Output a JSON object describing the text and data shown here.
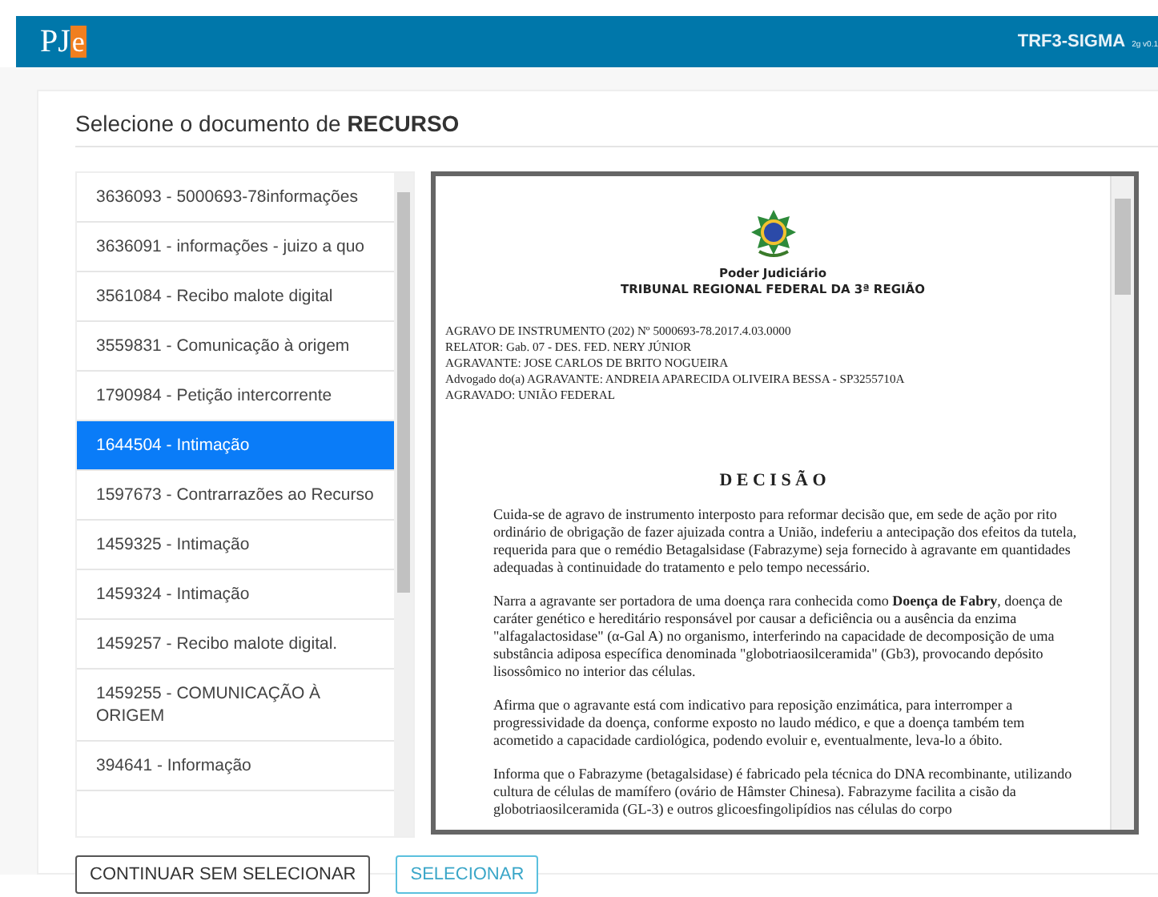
{
  "header": {
    "logo": [
      "PJ",
      "e"
    ],
    "app_name": "TRF3-SIGMA",
    "version": "2g v0.1"
  },
  "page_title": "Selecione o documento de **RECURSO**",
  "documents": [
    {
      "label": "3636093 - 5000693-78informações",
      "selected": false
    },
    {
      "label": "3636091 - informações - juizo a quo",
      "selected": false
    },
    {
      "label": "3561084 - Recibo malote digital",
      "selected": false
    },
    {
      "label": "3559831 - Comunicação à origem",
      "selected": false
    },
    {
      "label": "1790984 - Petição intercorrente",
      "selected": false
    },
    {
      "label": "1644504 - Intimação",
      "selected": true
    },
    {
      "label": "1597673 - Contrarrazões ao Recurso",
      "selected": false
    },
    {
      "label": "1459325 - Intimação",
      "selected": false
    },
    {
      "label": "1459324 - Intimação",
      "selected": false
    },
    {
      "label": "1459257 - Recibo malote digital.",
      "selected": false
    },
    {
      "label": "1459255 - COMUNICAÇÃO À ORIGEM",
      "selected": false
    },
    {
      "label": "394641 - Informação",
      "selected": false
    }
  ],
  "viewer": {
    "heading_lines": [
      "Poder Judiciário",
      "TRIBUNAL REGIONAL FEDERAL DA 3ª REGIÃO"
    ],
    "case_lines": [
      "AGRAVO DE INSTRUMENTO (202) Nº 5000693-78.2017.4.03.0000",
      "RELATOR: Gab. 07 - DES. FED. NERY JÚNIOR",
      "AGRAVANTE: JOSE CARLOS DE BRITO NOGUEIRA",
      "Advogado do(a) AGRAVANTE: ANDREIA APARECIDA OLIVEIRA BESSA - SP3255710A",
      "AGRAVADO: UNIÃO FEDERAL"
    ],
    "title": "D E C I S Ã O",
    "paragraphs": [
      "Cuida-se de agravo de instrumento interposto para reformar decisão que, em sede de ação por rito ordinário de obrigação de fazer ajuizada contra a União, indeferiu a antecipação dos efeitos da tutela, requerida para que o remédio Betagalsidase (Fabrazyme) seja fornecido à agravante em quantidades adequadas à continuidade do tratamento e pelo tempo necessário.",
      "Narra a agravante ser portadora de uma doença rara conhecida como **Doença de Fabry**, doença de caráter genético e hereditário responsável por causar a deficiência ou a ausência da enzima \"alfagalactosidase\" (α-Gal A) no organismo, interferindo na capacidade de decomposição de uma substância adiposa específica denominada \"globotriaosilceramida\" (Gb3), provocando depósito lisossômico no interior das células.",
      "Afirma que o agravante está com indicativo para reposição enzimática, para interromper a progressividade da doença, conforme exposto no laudo médico, e que a doença também tem acometido a capacidade cardiológica, podendo evoluir e, eventualmente, leva-lo a óbito.",
      "Informa que o Fabrazyme (betagalsidase) é fabricado pela técnica do DNA recombinante, utilizando cultura de células de mamífero (ovário de Hâmster Chinesa). Fabrazyme facilita a cisão da globotriaosilceramida (GL-3) e outros glicoesfingolipídios nas células do corpo"
    ]
  },
  "buttons": [
    {
      "label": "CONTINUAR SEM SELECIONAR",
      "kind": "default"
    },
    {
      "label": "SELECIONAR",
      "kind": "primary"
    }
  ]
}
